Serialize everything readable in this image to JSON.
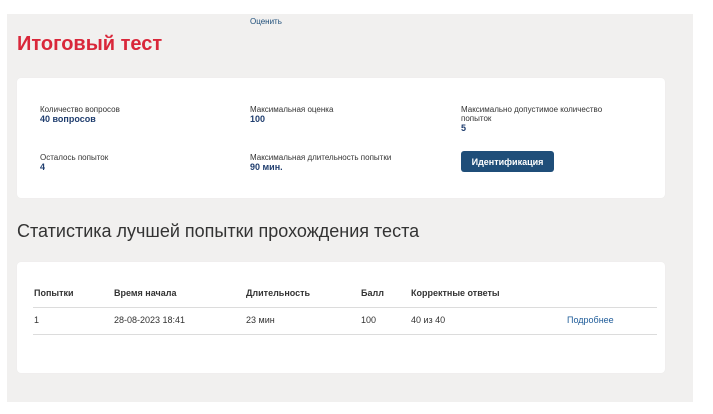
{
  "top_link": "Оценить",
  "page_title": "Итоговый тест",
  "info": {
    "questions_label": "Количество вопросов",
    "questions_value": "40 вопросов",
    "max_score_label": "Максимальная оценка",
    "max_score_value": "100",
    "max_attempts_label_line1": "Максимально допустимое количество",
    "max_attempts_label_line2": "попыток",
    "max_attempts_value": "5",
    "remaining_label": "Осталось попыток",
    "remaining_value": "4",
    "max_duration_label": "Максимальная длительность попытки",
    "max_duration_value": "90 мин.",
    "identify_button": "Идентификация"
  },
  "stats": {
    "title": "Статистика лучшей попытки прохождения теста",
    "columns": [
      "Попытки",
      "Время начала",
      "Длительность",
      "Балл",
      "Корректные ответы"
    ],
    "rows": [
      {
        "attempt": "1",
        "start_time": "28-08-2023 18:41",
        "duration": "23 мин",
        "score": "100",
        "correct": "40 из 40",
        "details": "Подробнее"
      }
    ]
  },
  "colors": {
    "title_red": "#d9273a",
    "accent_blue": "#1f4e79",
    "background_gray": "#f1f0ef"
  }
}
